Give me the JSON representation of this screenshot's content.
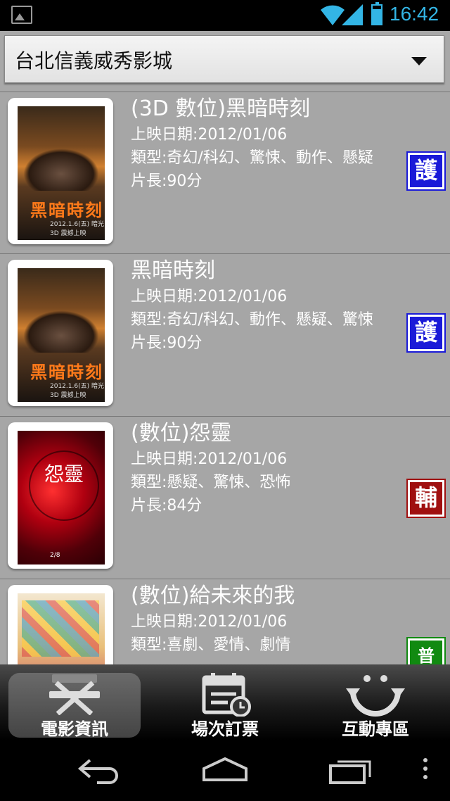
{
  "status_bar": {
    "time": "16:42"
  },
  "cinema_selector": {
    "selected": "台北信義威秀影城"
  },
  "movies": [
    {
      "title": "(3D 數位)黑暗時刻",
      "release": "上映日期:2012/01/06",
      "genre": "類型:奇幻/科幻、驚悚、動作、懸疑",
      "length": "片長:90分",
      "rating": "護",
      "rating_color": "#1a1ad8",
      "poster": {
        "title": "黑暗時刻",
        "sub": "2012.1.6(五) 暗光3D 震撼上映"
      }
    },
    {
      "title": "黑暗時刻",
      "release": "上映日期:2012/01/06",
      "genre": "類型:奇幻/科幻、動作、懸疑、驚悚",
      "length": "片長:90分",
      "rating": "護",
      "rating_color": "#1a1ad8",
      "poster": {
        "title": "黑暗時刻",
        "sub": "2012.1.6(五) 暗光3D 震撼上映"
      }
    },
    {
      "title": "(數位)怨靈",
      "release": "上映日期:2012/01/06",
      "genre": "類型:懸疑、驚悚、恐怖",
      "length": "片長:84分",
      "rating": "輔",
      "rating_color": "#a01010",
      "poster": {
        "title": "怨靈",
        "sub": "2/8"
      }
    },
    {
      "title": "(數位)給未來的我",
      "release": "上映日期:2012/01/06",
      "genre": "類型:喜劇、愛情、劇情",
      "length": "",
      "rating": "普",
      "rating_color": "#118a11",
      "poster": {
        "title": "",
        "sub": ""
      }
    }
  ],
  "tabs": [
    {
      "label": "電影資訊",
      "icon": "directors-chair-icon",
      "active": true
    },
    {
      "label": "場次訂票",
      "icon": "calendar-clock-icon",
      "active": false
    },
    {
      "label": "互動專區",
      "icon": "smiley-arrows-icon",
      "active": false
    }
  ],
  "nav": {
    "back": "back-icon",
    "home": "home-icon",
    "recent": "recent-apps-icon",
    "menu": "menu-icon"
  }
}
